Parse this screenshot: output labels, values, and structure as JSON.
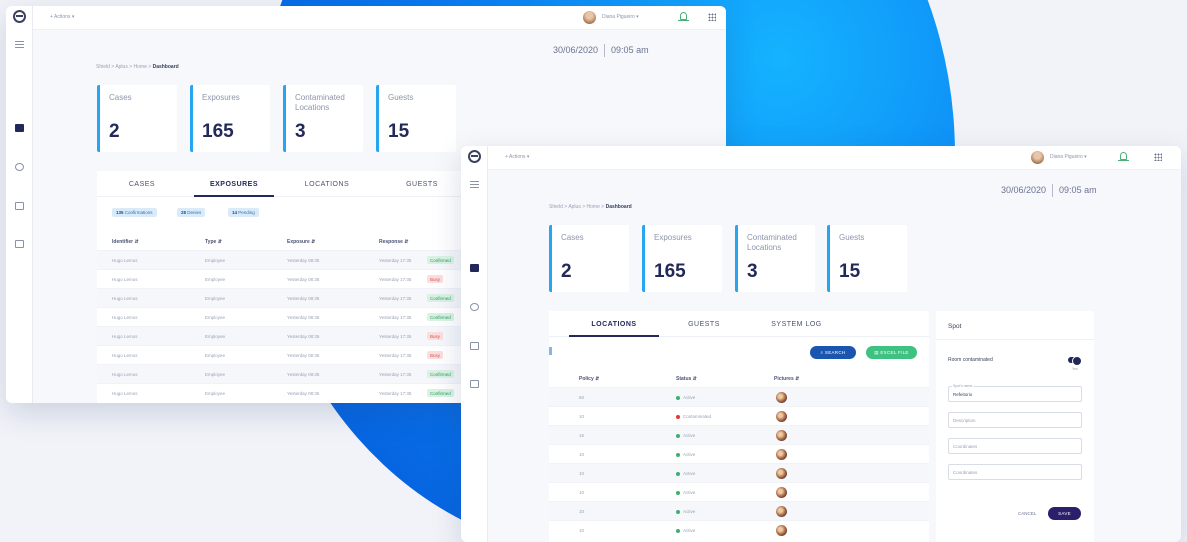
{
  "common": {
    "actions_label": "+ Actions ▾",
    "user_name": "Diana Pigueiro ▾",
    "date": "30/06/2020",
    "time": "09:05 am",
    "breadcrumb": {
      "trail": "Shield > Aplus > Home >",
      "current": "Dashboard"
    }
  },
  "stats": [
    {
      "label": "Cases",
      "value": "2"
    },
    {
      "label": "Exposures",
      "value": "165"
    },
    {
      "label": "Contaminated Locations",
      "value": "3"
    },
    {
      "label": "Guests",
      "value": "15"
    }
  ],
  "window1": {
    "tabs": [
      "CASES",
      "EXPOSURES",
      "LOCATIONS",
      "GUESTS"
    ],
    "active_tab": "EXPOSURES",
    "chips": [
      {
        "count": "135",
        "label": "Confirmations"
      },
      {
        "count": "28",
        "label": "Denies"
      },
      {
        "count": "14",
        "label": "Pending"
      }
    ],
    "columns": [
      "Identifier ⇵",
      "Type ⇵",
      "Exposure ⇵",
      "Response ⇵"
    ],
    "rows": [
      {
        "id": "Hugo Lemos",
        "type": "Employee",
        "exposure": "Yesterday 08:35",
        "response": "Yesterday 17:35",
        "status": "Confirmed",
        "kind": "ok"
      },
      {
        "id": "Hugo Lemos",
        "type": "Employee",
        "exposure": "Yesterday 08:35",
        "response": "Yesterday 17:35",
        "status": "Busy",
        "kind": "busy"
      },
      {
        "id": "Hugo Lemos",
        "type": "Employee",
        "exposure": "Yesterday 08:35",
        "response": "Yesterday 17:35",
        "status": "Confirmed",
        "kind": "ok"
      },
      {
        "id": "Hugo Lemos",
        "type": "Employee",
        "exposure": "Yesterday 08:35",
        "response": "Yesterday 17:35",
        "status": "Confirmed",
        "kind": "ok"
      },
      {
        "id": "Hugo Lemos",
        "type": "Employee",
        "exposure": "Yesterday 08:35",
        "response": "Yesterday 17:35",
        "status": "Busy",
        "kind": "busy"
      },
      {
        "id": "Hugo Lemos",
        "type": "Employee",
        "exposure": "Yesterday 08:35",
        "response": "Yesterday 17:35",
        "status": "Busy",
        "kind": "busy"
      },
      {
        "id": "Hugo Lemos",
        "type": "Employee",
        "exposure": "Yesterday 08:35",
        "response": "Yesterday 17:35",
        "status": "Confirmed",
        "kind": "ok"
      },
      {
        "id": "Hugo Lemos",
        "type": "Employee",
        "exposure": "Yesterday 08:35",
        "response": "Yesterday 17:35",
        "status": "Confirmed",
        "kind": "ok"
      }
    ]
  },
  "window2": {
    "tabs": [
      "LOCATIONS",
      "GUESTS",
      "SYSTEM LOG"
    ],
    "active_tab": "LOCATIONS",
    "search_label": "SEARCH",
    "excel_label": "EXCEL FILE",
    "columns": [
      "Policy ⇵",
      "Status ⇵",
      "Pictures ⇵"
    ],
    "rows": [
      {
        "policy": "50",
        "status": "Active",
        "color": "#3bb273"
      },
      {
        "policy": "10",
        "status": "Contaminated",
        "color": "#e0393e"
      },
      {
        "policy": "15",
        "status": "Active",
        "color": "#3bb273"
      },
      {
        "policy": "10",
        "status": "Active",
        "color": "#3bb273"
      },
      {
        "policy": "10",
        "status": "Active",
        "color": "#3bb273"
      },
      {
        "policy": "10",
        "status": "Active",
        "color": "#3bb273"
      },
      {
        "policy": "10",
        "status": "Active",
        "color": "#3bb273"
      },
      {
        "policy": "10",
        "status": "Active",
        "color": "#3bb273"
      }
    ],
    "side": {
      "title": "Spot",
      "toggle_label": "Room contaminated",
      "toggle_state": "Yes",
      "fields": [
        {
          "label": "Spot's name",
          "value": "Refeitorio",
          "placeholder": ""
        },
        {
          "label": "",
          "value": "",
          "placeholder": "Description"
        },
        {
          "label": "",
          "value": "",
          "placeholder": "Coordinates"
        },
        {
          "label": "",
          "value": "",
          "placeholder": "Coordinates"
        }
      ],
      "cancel_label": "CANCEL",
      "save_label": "SAVE"
    }
  },
  "colors": {
    "accent": "#27a6ef",
    "navy": "#232958",
    "search": "#1a56b0",
    "excel": "#3fc281"
  }
}
